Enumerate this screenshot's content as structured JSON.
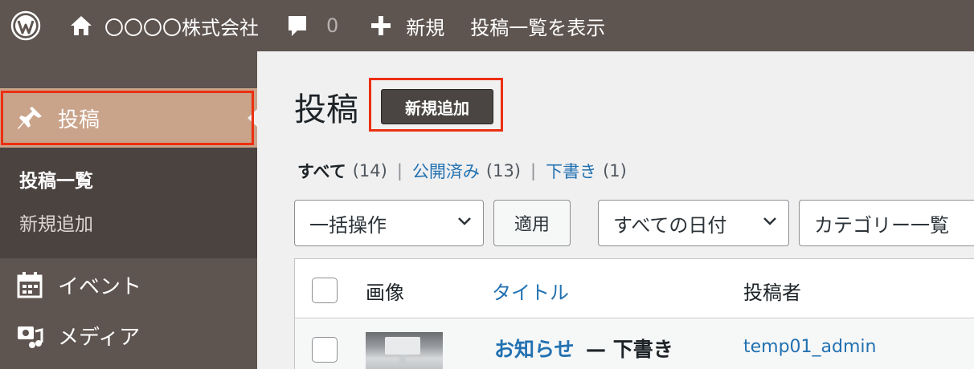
{
  "adminbar": {
    "site_name": "〇〇〇〇株式会社",
    "comment_count": "0",
    "new_label": "新規",
    "view_posts": "投稿一覧を表示",
    "icons": [
      "wordpress-icon",
      "home-icon",
      "comment-icon",
      "plus-icon"
    ]
  },
  "sidebar": {
    "posts_label": "投稿",
    "submenu": [
      "投稿一覧",
      "新規追加"
    ],
    "events_label": "イベント",
    "media_label": "メディア"
  },
  "main": {
    "title": "投稿",
    "add_new": "新規追加",
    "filters": {
      "all_label": "すべて",
      "all_count": "(14)",
      "published_label": "公開済み",
      "published_count": "(13)",
      "draft_label": "下書き",
      "draft_count": "(1)",
      "separator": "|"
    },
    "bulk_actions": "一括操作",
    "apply": "適用",
    "all_dates": "すべての日付",
    "category": "カテゴリー一覧"
  },
  "table": {
    "headers": [
      "画像",
      "タイトル",
      "投稿者"
    ],
    "rows": [
      {
        "title": "お知らせ",
        "state": "— 下書き",
        "author": "temp01_admin"
      }
    ]
  },
  "colors": {
    "admin_bar": "#5e5450",
    "menu_active": "#c9a38a",
    "highlight_box": "#ec2f11",
    "link": "#2271b1"
  }
}
